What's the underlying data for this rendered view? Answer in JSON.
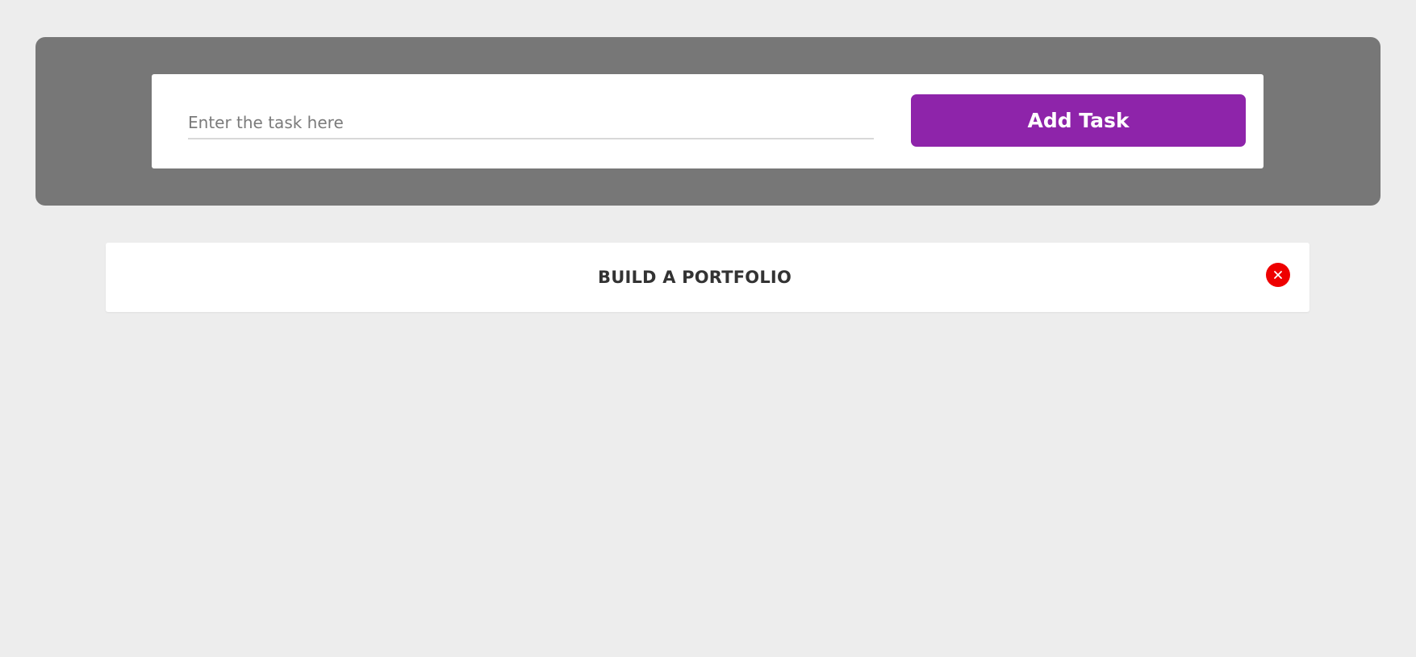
{
  "input": {
    "placeholder": "Enter the task here",
    "value": ""
  },
  "add_button": {
    "label": "Add Task"
  },
  "tasks": [
    {
      "text": "BUILD A PORTFOLIO",
      "delete_icon": "close-icon"
    }
  ],
  "colors": {
    "background": "#ededed",
    "header_panel": "#777777",
    "card": "#ffffff",
    "accent_button": "#8e24aa",
    "delete_button": "#ee0000",
    "task_text": "#333333"
  }
}
